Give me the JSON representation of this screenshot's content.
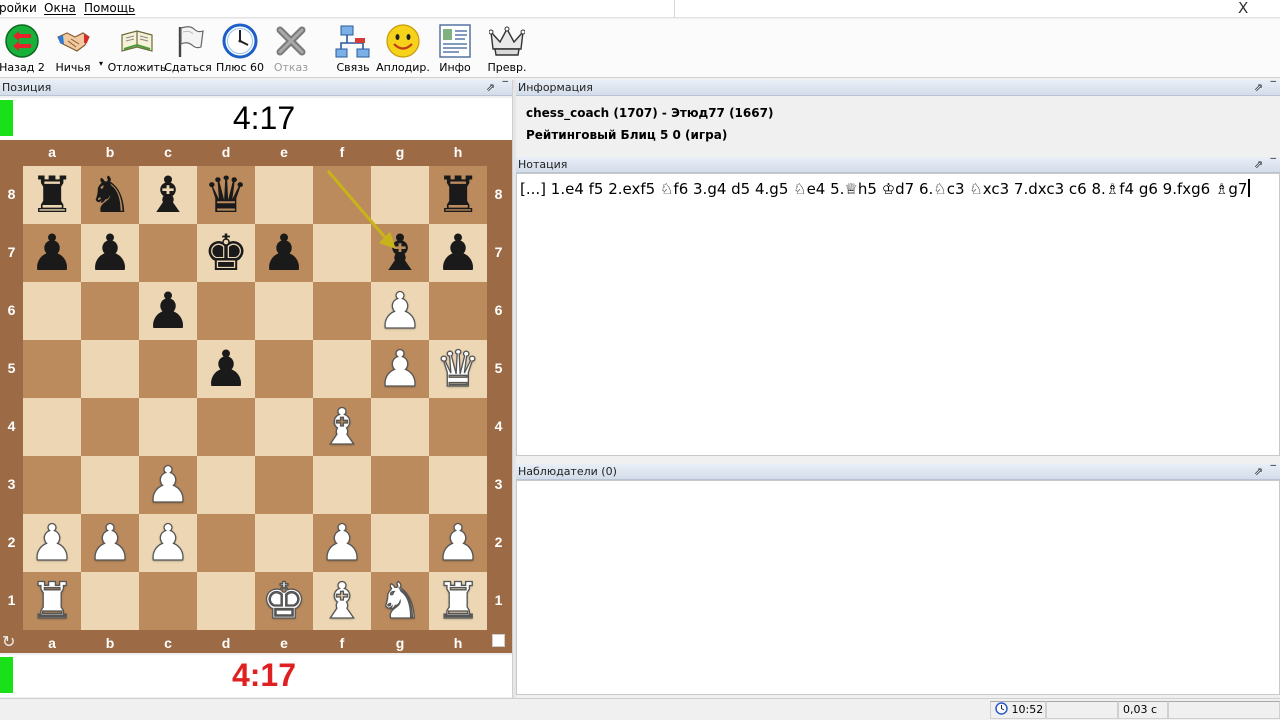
{
  "menubar": {
    "items": [
      "ройки",
      "Окна",
      "Помощь"
    ],
    "close_glyph": "X"
  },
  "toolbar": {
    "buttons": [
      {
        "label": "Назад 2",
        "icon": "back-arrows-icon"
      },
      {
        "label": "Ничья",
        "icon": "handshake-icon"
      },
      {
        "label": "Отложить",
        "icon": "adjourn-book-icon"
      },
      {
        "label": "Сдаться",
        "icon": "white-flag-icon"
      },
      {
        "label": "Плюс 60",
        "icon": "clock-icon"
      },
      {
        "label": "Отказ",
        "icon": "decline-x-icon",
        "disabled": true
      },
      {
        "label": "Связь",
        "icon": "network-icon"
      },
      {
        "label": "Аплодир.",
        "icon": "smiley-icon"
      },
      {
        "label": "Инфо",
        "icon": "info-card-icon"
      },
      {
        "label": "Превр.",
        "icon": "crown-promote-icon"
      }
    ],
    "dropdown_glyph": "▾"
  },
  "left_panel": {
    "title": "Позиция",
    "top_clock": "4:17",
    "bottom_clock": "4:17",
    "bottom_clock_color": "#e02020",
    "files": [
      "a",
      "b",
      "c",
      "d",
      "e",
      "f",
      "g",
      "h"
    ],
    "ranks": [
      "8",
      "7",
      "6",
      "5",
      "4",
      "3",
      "2",
      "1"
    ],
    "pieces": {
      "a8": "br",
      "b8": "bn",
      "c8": "bb",
      "d8": "bq",
      "h8": "br",
      "a7": "bp",
      "b7": "bp",
      "d7": "bk",
      "e7": "bp",
      "g7": "bb",
      "h7": "bp",
      "c6": "bp",
      "g6": "wp",
      "d5": "bp",
      "g5": "wp",
      "h5": "wq",
      "f4": "wb",
      "c3": "wp",
      "a2": "wp",
      "b2": "wp",
      "c2": "wp",
      "f2": "wp",
      "h2": "wp",
      "a1": "wr",
      "e1": "wk",
      "f1": "wb",
      "g1": "wn",
      "h1": "wr"
    },
    "last_move_from": "f8",
    "last_move_to": "g7",
    "colors": {
      "light": "#ecd6b3",
      "dark": "#bb8b5e",
      "frame": "#9c6a45",
      "arrow": "#c8b418"
    }
  },
  "info_panel": {
    "title": "Информация",
    "players": "chess_coach (1707) - Этюд77 (1667)",
    "game_type": "Рейтинговый Блиц 5 0  (игра)"
  },
  "notation_panel": {
    "title": "Нотация",
    "moves": "[...] 1.e4 f5 2.exf5 ♘f6 3.g4 d5 4.g5 ♘e4 5.♕h5 ♔d7 6.♘c3 ♘xc3 7.dxc3 c6 8.♗f4 g6 9.fxg6 ♗g7"
  },
  "observers_panel": {
    "title": "Наблюдатели (0)"
  },
  "statusbar": {
    "time": "10:52",
    "lag": "0,03 с"
  }
}
